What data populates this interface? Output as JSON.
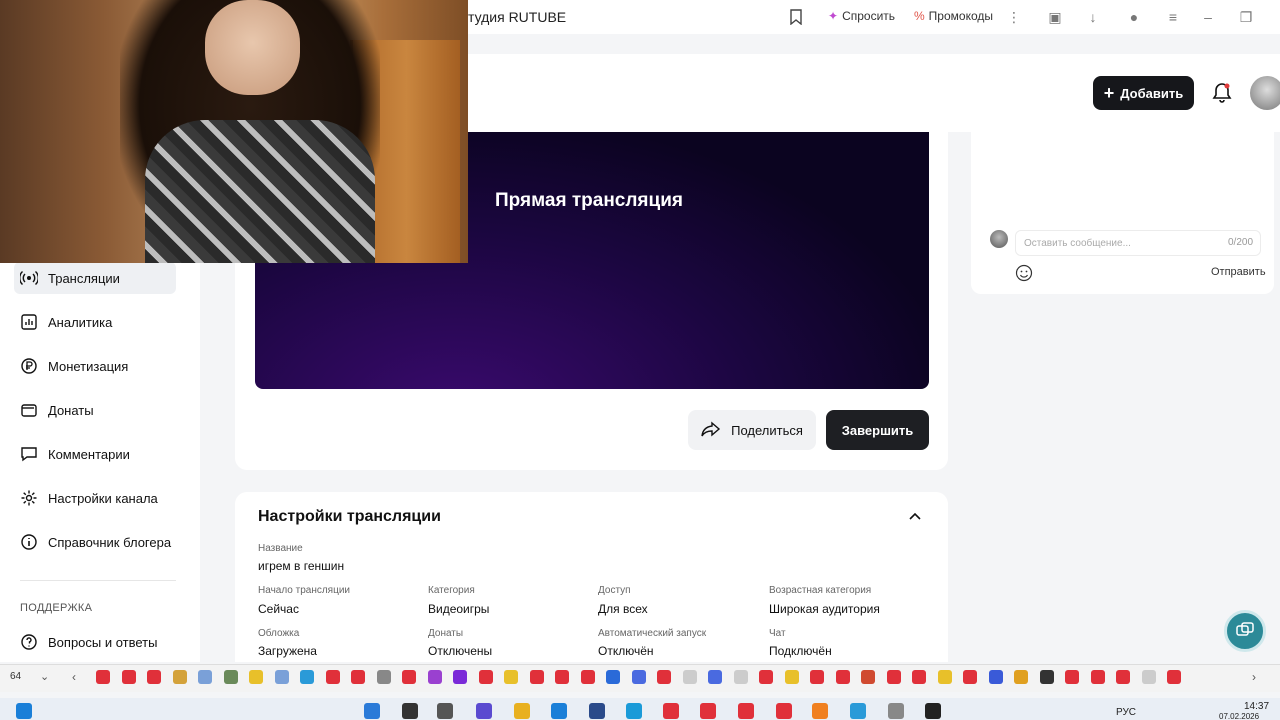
{
  "browser": {
    "tab_title": "тудия RUTUBE",
    "share_label": "Спросить",
    "promo_label": "Промокоды"
  },
  "header": {
    "add_label": "Добавить"
  },
  "sidebar": {
    "items": [
      {
        "label": "Трансляции",
        "icon": "broadcast-icon"
      },
      {
        "label": "Аналитика",
        "icon": "analytics-icon"
      },
      {
        "label": "Монетизация",
        "icon": "ruble-icon"
      },
      {
        "label": "Донаты",
        "icon": "wallet-icon"
      },
      {
        "label": "Комментарии",
        "icon": "comment-icon"
      },
      {
        "label": "Настройки канала",
        "icon": "gear-icon"
      },
      {
        "label": "Справочник блогера",
        "icon": "info-icon"
      }
    ],
    "support_label": "ПОДДЕРЖКА",
    "faq_label": "Вопросы и ответы"
  },
  "player": {
    "title": "Прямая трансляция"
  },
  "actions": {
    "share_label": "Поделиться",
    "finish_label": "Завершить"
  },
  "chat": {
    "placeholder": "Оставить сообщение...",
    "counter": "0/200",
    "send_label": "Отправить"
  },
  "settings": {
    "title": "Настройки трансляции",
    "name_label": "Название",
    "name_value": "игрем в геншин",
    "fields": [
      {
        "label": "Начало трансляции",
        "value": "Сейчас"
      },
      {
        "label": "Категория",
        "value": "Видеоигры"
      },
      {
        "label": "Доступ",
        "value": "Для всех"
      },
      {
        "label": "Возрастная категория",
        "value": "Широкая аудитория"
      },
      {
        "label": "Обложка",
        "value": "Загружена"
      },
      {
        "label": "Донаты",
        "value": "Отключены"
      },
      {
        "label": "Автоматический запуск",
        "value": "Отключён"
      },
      {
        "label": "Чат",
        "value": "Подключён"
      }
    ]
  },
  "taskbar": {
    "bookmark_count": "64",
    "language": "РУС",
    "time": "14:37",
    "date": "07.02.2026"
  },
  "colors": {
    "accent_dark": "#16171b",
    "player_purple": "#3a0a6e",
    "help_teal": "#2c8a98"
  }
}
